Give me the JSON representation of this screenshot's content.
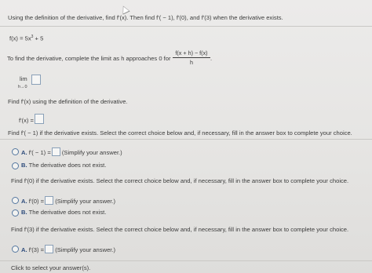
{
  "intro": "Using the definition of the derivative, find f'(x). Then find f'( − 1), f'(0), and f'(3) when the derivative exists.",
  "function_base": "f(x) = 5x",
  "function_exp": "3",
  "function_tail": " + 5",
  "limit_prompt": "To find the derivative, complete the limit as h approaches 0 for",
  "limit_numerator": "f(x + h) − f(x)",
  "limit_denominator": "h",
  "limit_period": ".",
  "lim_word": "lim",
  "lim_sub": "h→0",
  "find_fx_prompt": "Find f'(x) using the definition of the derivative.",
  "fx_label": "f'(x) =",
  "q1": {
    "prompt": "Find f'( − 1) if the derivative exists. Select the correct choice below and, if necessary, fill in the answer box to complete your choice.",
    "option_a_letter": "A.",
    "option_a_expr": "f'( − 1) =",
    "option_a_hint": "(Simplify your answer.)",
    "option_b_letter": "B.",
    "option_b_text": "The derivative does not exist."
  },
  "q2": {
    "prompt": "Find f'(0) if the derivative exists. Select the correct choice below and, if necessary, fill in the answer box to complete your choice.",
    "option_a_letter": "A.",
    "option_a_expr": "f'(0) =",
    "option_a_hint": "(Simplify your answer.)",
    "option_b_letter": "B.",
    "option_b_text": "The derivative does not exist."
  },
  "q3": {
    "prompt": "Find f'(3) if the derivative exists. Select the correct choice below and, if necessary, fill in the answer box to complete your choice.",
    "option_a_letter": "A.",
    "option_a_expr": "f'(3) =",
    "option_a_hint": "(Simplify your answer.)"
  },
  "footer": "Click to select your answer(s)."
}
